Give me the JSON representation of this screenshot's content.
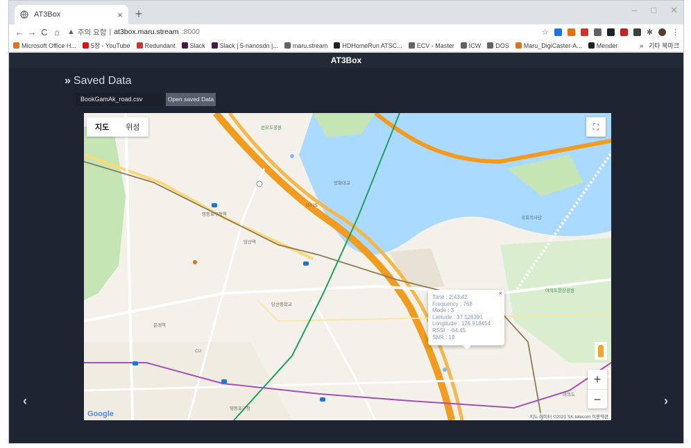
{
  "browser": {
    "tab_title": "AT3Box",
    "tab_close": "×",
    "new_tab": "+",
    "window_controls": [
      "–",
      "□",
      "✕"
    ],
    "nav": {
      "back": "←",
      "forward": "→",
      "reload": "C",
      "home": "⌂"
    },
    "security_label": "주의 요함",
    "url_host": "at3box.maru.stream",
    "url_port": ":8000",
    "bookmarks": [
      {
        "label": "Microsoft Office H...",
        "color": "#e8710a"
      },
      {
        "label": "5장 - YouTube",
        "color": "#ff0000"
      },
      {
        "label": "Redundant",
        "color": "#d93025"
      },
      {
        "label": "Slack",
        "color": "#4a154b"
      },
      {
        "label": "Slack | 5-nanosdn |...",
        "color": "#4a154b"
      },
      {
        "label": "maru.stream",
        "color": "#5f6368"
      },
      {
        "label": "HDHomeRun ATSC...",
        "color": "#202124"
      },
      {
        "label": "ECV - Master",
        "color": "#5f6368"
      },
      {
        "label": "ICW",
        "color": "#5f6368"
      },
      {
        "label": "DOS",
        "color": "#5f6368"
      },
      {
        "label": "Maru_DigiCaster-A...",
        "color": "#e8710a"
      },
      {
        "label": "Mender",
        "color": "#202124"
      }
    ],
    "bookmarks_other": "기타 북마크",
    "bookmarks_more": "»"
  },
  "page": {
    "navbar_title": "AT3Box",
    "section_title": "Saved Data",
    "file_name": "BookGamAk_road.csv",
    "open_button": "Open saved Data",
    "prev_arrow": "‹",
    "next_arrow": "›"
  },
  "map": {
    "type_map": "지도",
    "type_satellite": "위성",
    "fullscreen_icon": "⛶",
    "zoom_in": "+",
    "zoom_out": "−",
    "google_logo": "Google",
    "attribution": "지도 데이터 ©2021 SK telecom  이용약관",
    "labels": [
      {
        "text": "당산역",
        "cls": ""
      },
      {
        "text": "영등포구청역",
        "cls": ""
      },
      {
        "text": "선유도공원",
        "cls": "green"
      },
      {
        "text": "양화대교",
        "cls": ""
      },
      {
        "text": "여의도한강공원",
        "cls": "green"
      },
      {
        "text": "여의도",
        "cls": ""
      },
      {
        "text": "국회의사당",
        "cls": ""
      },
      {
        "text": "당산중학교",
        "cls": ""
      },
      {
        "text": "문래역",
        "cls": ""
      },
      {
        "text": "CU",
        "cls": ""
      },
      {
        "text": "GS25",
        "cls": ""
      },
      {
        "text": "영등포구청",
        "cls": ""
      }
    ],
    "infowindow": {
      "close": "×",
      "lines": [
        "Time : 2:43:42",
        "Frequency : 768",
        "Mode : 3",
        "Latitude : 37.526391",
        "Longitude : 126.918454",
        "RSSI : -64.45",
        "SNR : 19"
      ]
    }
  },
  "colors": {
    "page_bg": "#1e2430",
    "navbar_bg": "#222a36",
    "button_bg": "#575e6c",
    "water": "#aadaff",
    "highway": "#f29b1c",
    "park": "#c5e5b5",
    "measure_track": "#1aa260",
    "subway_line": "#a34fb5"
  }
}
